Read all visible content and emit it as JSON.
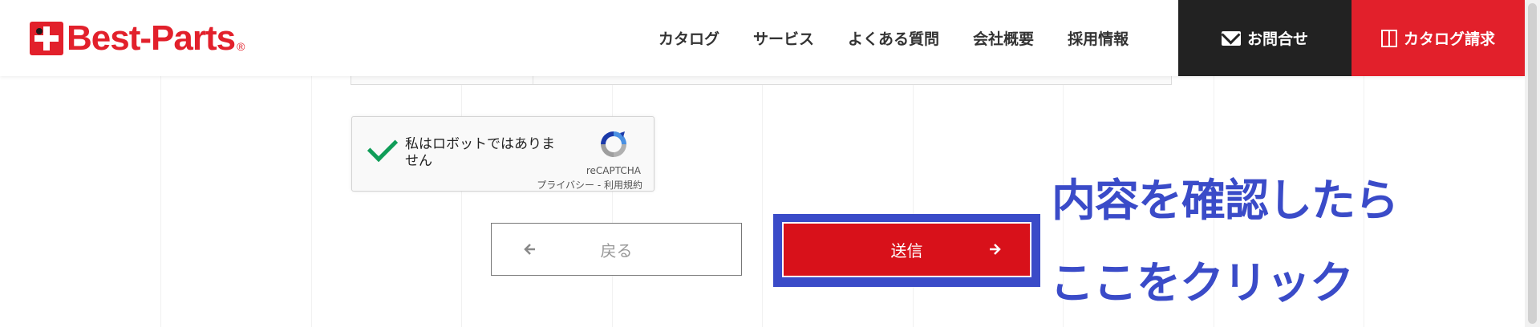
{
  "header": {
    "logo_text": "Best-Parts",
    "logo_reg": "®",
    "nav": [
      "カタログ",
      "サービス",
      "よくある質問",
      "会社概要",
      "採用情報"
    ],
    "contact_label": "お問合せ",
    "catalog_request_label": "カタログ請求"
  },
  "recaptcha": {
    "label": "私はロボットではありません",
    "brand": "reCAPTCHA",
    "links": "プライバシー - 利用規約",
    "checked": true
  },
  "buttons": {
    "back_label": "戻る",
    "send_label": "送信"
  },
  "annotation": {
    "line1": "内容を確認したら",
    "line2": "ここをクリック",
    "color": "#3a4bc8"
  },
  "colors": {
    "brand_red": "#e2202b",
    "send_red": "#d8111a",
    "contact_dark": "#222222"
  }
}
